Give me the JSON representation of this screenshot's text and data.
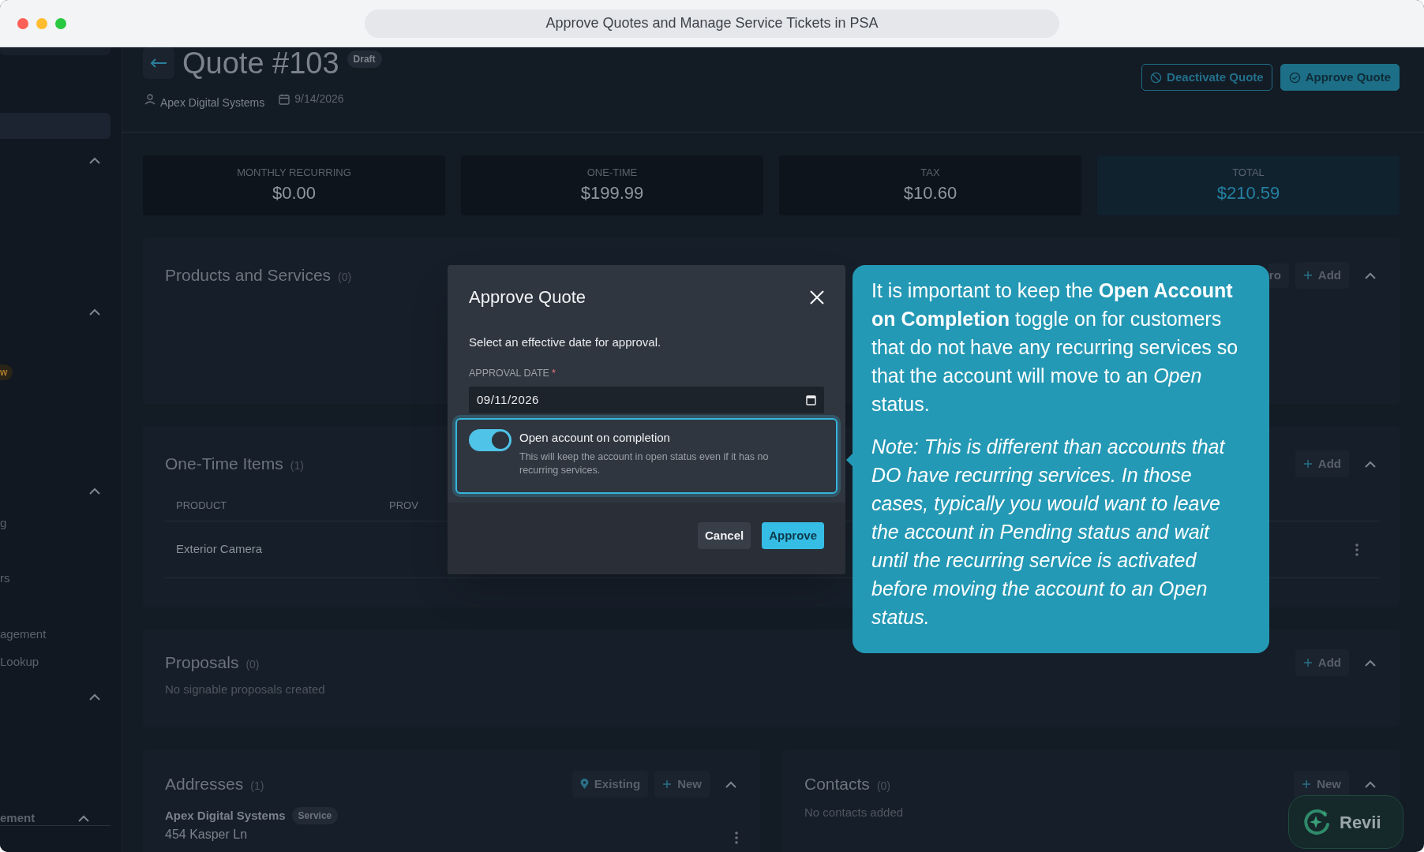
{
  "browser": {
    "title": "Approve Quotes and Manage Service Tickets in PSA"
  },
  "sidebar": {
    "items": [
      {
        "kind": "bar"
      },
      {
        "kind": "highlight",
        "selected": true
      },
      {
        "kind": "chevron"
      },
      {
        "kind": "chevron"
      },
      {
        "kind": "badge",
        "label": "w"
      },
      {
        "kind": "chevron"
      },
      {
        "kind": "link",
        "label": "g"
      },
      {
        "kind": "link",
        "label": "rs"
      },
      {
        "kind": "link",
        "label": "agement"
      },
      {
        "kind": "link",
        "label": "Lookup"
      },
      {
        "kind": "chevron"
      },
      {
        "kind": "group",
        "label": "ement"
      }
    ]
  },
  "header": {
    "title": "Quote #103",
    "badge": "Draft",
    "customer": "Apex Digital Systems",
    "date": "9/14/2026",
    "actions": [
      {
        "label": "Deactivate Quote",
        "kind": "outline"
      },
      {
        "label": "Approve Quote",
        "kind": "primary"
      }
    ]
  },
  "summary": [
    {
      "label": "MONTHLY RECURRING",
      "value": "$0.00",
      "highlighted": false
    },
    {
      "label": "ONE-TIME",
      "value": "$199.99",
      "highlighted": false
    },
    {
      "label": "TAX",
      "value": "$10.60",
      "highlighted": false
    },
    {
      "label": "TOTAL",
      "value": "$210.59",
      "highlighted": true
    }
  ],
  "products": {
    "title": "Products and Services",
    "count": "(0)",
    "expanded": true,
    "actions": [
      {
        "label": "ro",
        "kind": "plain"
      },
      {
        "label": "Add",
        "kind": "plus"
      }
    ]
  },
  "one_time_items": {
    "title": "One-Time Items",
    "count": "(1)",
    "expanded": true,
    "actions": [
      {
        "label": "Add",
        "kind": "plus"
      }
    ],
    "table": {
      "columns": [
        "PRODUCT",
        "PROV"
      ],
      "rows": [
        {
          "cells": [
            "Exterior Camera"
          ]
        }
      ]
    }
  },
  "proposals": {
    "title": "Proposals",
    "count": "(0)",
    "expanded": true,
    "actions": [
      {
        "label": "Add",
        "kind": "plus"
      }
    ],
    "empty_text": "No signable proposals created"
  },
  "addresses": {
    "title": "Addresses",
    "count": "(1)",
    "expanded": true,
    "actions": [
      {
        "label": "Existing",
        "kind": "pin"
      },
      {
        "label": "New",
        "kind": "plus"
      }
    ],
    "entries": [
      {
        "name": "Apex Digital Systems",
        "tag": "Service",
        "line": "454 Kasper Ln"
      }
    ]
  },
  "contacts": {
    "title": "Contacts",
    "count": "(0)",
    "expanded": true,
    "actions": [
      {
        "label": "New",
        "kind": "plus"
      }
    ],
    "empty_text": "No contacts added"
  },
  "modal": {
    "title": "Approve Quote",
    "description": "Select an effective date for approval.",
    "field": {
      "label": "APPROVAL DATE",
      "required_mark": "*",
      "value": "09/11/2026"
    },
    "toggle": {
      "label": "Open account on completion",
      "hint": "This will keep the account in open status even if it has no recurring services.",
      "on": true
    },
    "buttons": [
      {
        "label": "Cancel",
        "kind": "secondary"
      },
      {
        "label": "Approve",
        "kind": "primary"
      }
    ]
  },
  "callout": {
    "paragraphs": [
      {
        "text": "It is important to keep the **Open Account on Completion** toggle on for customers that do not have any recurring services so that the account will move to an *Open* status.",
        "italic": false
      },
      {
        "text": "Note: This is different than accounts that DO have recurring services. In those cases, typically you would want to leave the account in Pending status and wait until the recurring service is activated before moving the account to an Open status.",
        "italic": true
      }
    ]
  },
  "assistant": {
    "label": "Revii"
  }
}
